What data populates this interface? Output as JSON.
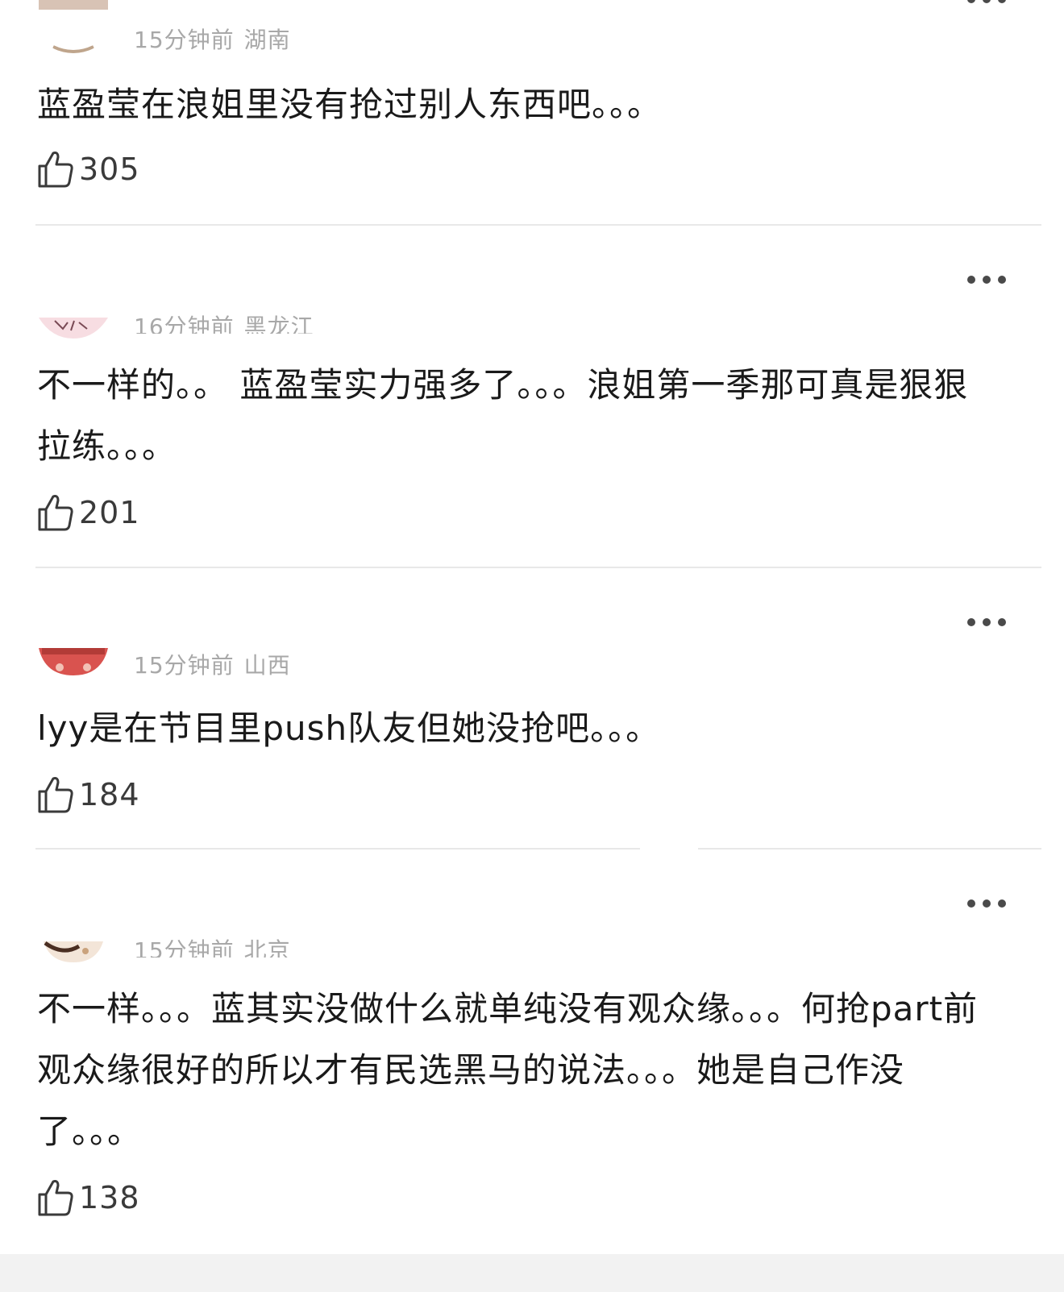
{
  "comments": [
    {
      "time": "15分钟前",
      "region": "湖南",
      "text": "蓝盈莹在浪姐里没有抢过别人东西吧。。。",
      "likes": "305",
      "avatar_color": "#e9d7c4"
    },
    {
      "time": "16分钟前",
      "region": "黑龙江",
      "text": "不一样的。。 蓝盈莹实力强多了。。。浪姐第一季那可真是狠狠拉练。。。",
      "likes": "201",
      "avatar_color": "#f6d6dc"
    },
    {
      "time": "15分钟前",
      "region": "山西",
      "text": "lyy是在节目里push队友但她没抢吧。。。",
      "likes": "184",
      "avatar_color": "#d9534f"
    },
    {
      "time": "15分钟前",
      "region": "北京",
      "text": "不一样。。。蓝其实没做什么就单纯没有观众缘。。。何抢part前观众缘很好的所以才有民选黑马的说法。。。她是自己作没了。。。",
      "likes": "138",
      "avatar_color": "#caa27c"
    }
  ],
  "icons": {
    "more": "more-dots-icon",
    "like": "thumbs-up-icon"
  }
}
